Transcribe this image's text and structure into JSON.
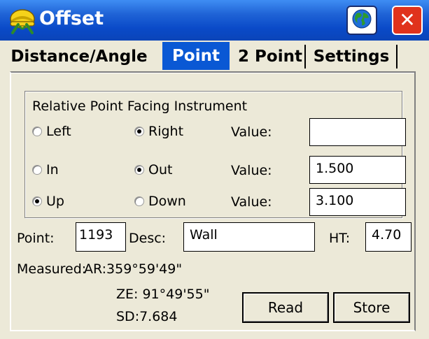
{
  "window": {
    "title": "Offset"
  },
  "icons": {
    "app": "surveyor-helmet-icon",
    "globe": "globe-icon",
    "close": "close-icon"
  },
  "close_label": "✕",
  "tabs": [
    {
      "label": "Distance/Angle",
      "active": false
    },
    {
      "label": "Point",
      "active": true
    },
    {
      "label": "2 Point",
      "active": false
    },
    {
      "label": "Settings",
      "active": false
    }
  ],
  "group": {
    "title": "Relative Point Facing Instrument",
    "rows": [
      {
        "left_label": "Left",
        "left_selected": false,
        "right_label": "Right",
        "right_selected": true,
        "value_label": "Value:",
        "value": ""
      },
      {
        "left_label": "In",
        "left_selected": false,
        "right_label": "Out",
        "right_selected": true,
        "value_label": "Value:",
        "value": "1.500"
      },
      {
        "left_label": "Up",
        "left_selected": true,
        "right_label": "Down",
        "right_selected": false,
        "value_label": "Value:",
        "value": "3.100"
      }
    ]
  },
  "point": {
    "point_label": "Point:",
    "point_value": "1193",
    "desc_label": "Desc:",
    "desc_value": "Wall",
    "ht_label": "HT:",
    "ht_value": "4.70"
  },
  "measured": {
    "label": "Measured:",
    "ar": "AR:359°59'49\"",
    "ze": "ZE: 91°49'55\"",
    "sd": "SD:7.684"
  },
  "buttons": {
    "read": "Read",
    "store": "Store"
  },
  "colors": {
    "titlebar": "#0a4ac8",
    "active_tab": "#0a58d4",
    "window_bg": "#ece9d8",
    "close": "#e0321c"
  }
}
